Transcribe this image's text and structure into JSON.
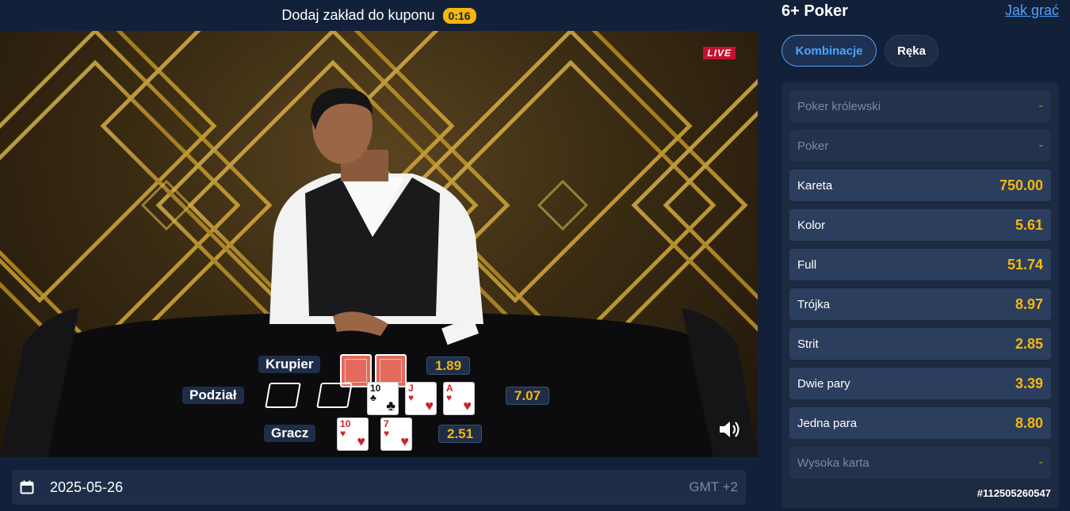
{
  "banner": {
    "text": "Dodaj zakład do kuponu",
    "timer": "0:16"
  },
  "stream": {
    "live_label": "LIVE",
    "rows": {
      "dealer": {
        "label": "Krupier",
        "odds": "1.89"
      },
      "split": {
        "label": "Podział",
        "odds": "7.07"
      },
      "player": {
        "label": "Gracz",
        "odds": "2.51"
      }
    },
    "community_cards": [
      {
        "rank": "10",
        "suit": "♣",
        "color": "black"
      },
      {
        "rank": "J",
        "suit": "♥",
        "color": "red"
      },
      {
        "rank": "A",
        "suit": "♥",
        "color": "red"
      }
    ],
    "player_cards": [
      {
        "rank": "10",
        "suit": "♥",
        "color": "red"
      },
      {
        "rank": "7",
        "suit": "♥",
        "color": "red"
      }
    ]
  },
  "date_bar": {
    "date": "2025-05-26",
    "timezone": "GMT +2"
  },
  "panel": {
    "title": "6+ Poker",
    "how_to_play": "Jak grać",
    "tabs": {
      "combinations": "Kombinacje",
      "hand": "Ręka"
    },
    "bets": [
      {
        "name": "Poker królewski",
        "odds": "-",
        "enabled": false
      },
      {
        "name": "Poker",
        "odds": "-",
        "enabled": false
      },
      {
        "name": "Kareta",
        "odds": "750.00",
        "enabled": true
      },
      {
        "name": "Kolor",
        "odds": "5.61",
        "enabled": true
      },
      {
        "name": "Full",
        "odds": "51.74",
        "enabled": true
      },
      {
        "name": "Trójka",
        "odds": "8.97",
        "enabled": true
      },
      {
        "name": "Strit",
        "odds": "2.85",
        "enabled": true
      },
      {
        "name": "Dwie pary",
        "odds": "3.39",
        "enabled": true
      },
      {
        "name": "Jedna para",
        "odds": "8.80",
        "enabled": true
      },
      {
        "name": "Wysoka karta",
        "odds": "-",
        "enabled": false
      }
    ],
    "round_id": "#112505260547"
  },
  "colors": {
    "accent": "#4da3ff",
    "odds": "#f5b70c",
    "live": "#c8102e",
    "background": "#13203a"
  }
}
